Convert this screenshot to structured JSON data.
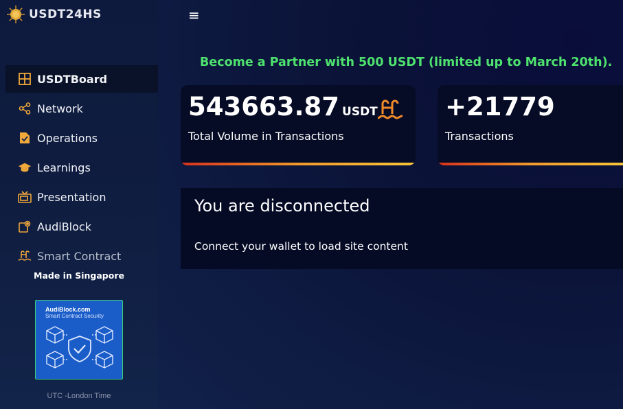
{
  "app": {
    "logo_text": "USDT24HS"
  },
  "sidebar": {
    "items": [
      {
        "label": "USDTBoard",
        "icon": "grid-icon",
        "active": true
      },
      {
        "label": "Network",
        "icon": "share-icon"
      },
      {
        "label": "Operations",
        "icon": "document-check-icon"
      },
      {
        "label": "Learnings",
        "icon": "graduation-cap-icon"
      },
      {
        "label": "Presentation",
        "icon": "tv-icon"
      },
      {
        "label": "AudiBlock",
        "icon": "map-pin-icon"
      },
      {
        "label": "Smart Contract",
        "icon": "pool-ladder-icon"
      }
    ],
    "made_in": "Made in Singapore",
    "badge": {
      "title": "AudiBlock.com",
      "subtitle": "Smart Contract Security"
    },
    "utc_text": "UTC -London Time"
  },
  "header": {
    "menu_icon": "hamburger-icon",
    "menu_glyph": "≡"
  },
  "promo_text": "Become a Partner with 500 USDT (limited up to March 20th).",
  "stats": [
    {
      "value": "543663.87",
      "unit": "USDT",
      "label": "Total Volume in Transactions",
      "icon": "pool-ladder-icon"
    },
    {
      "value": "+21779",
      "label": "Transactions"
    }
  ],
  "status": {
    "title": "You are disconnected",
    "message": "Connect your wallet to load site content"
  },
  "colors": {
    "accent_green": "#4ee36e",
    "accent_orange": "#f39a2a",
    "sidebar_bg": "#0e1a3d",
    "card_bg": "#070c26"
  }
}
